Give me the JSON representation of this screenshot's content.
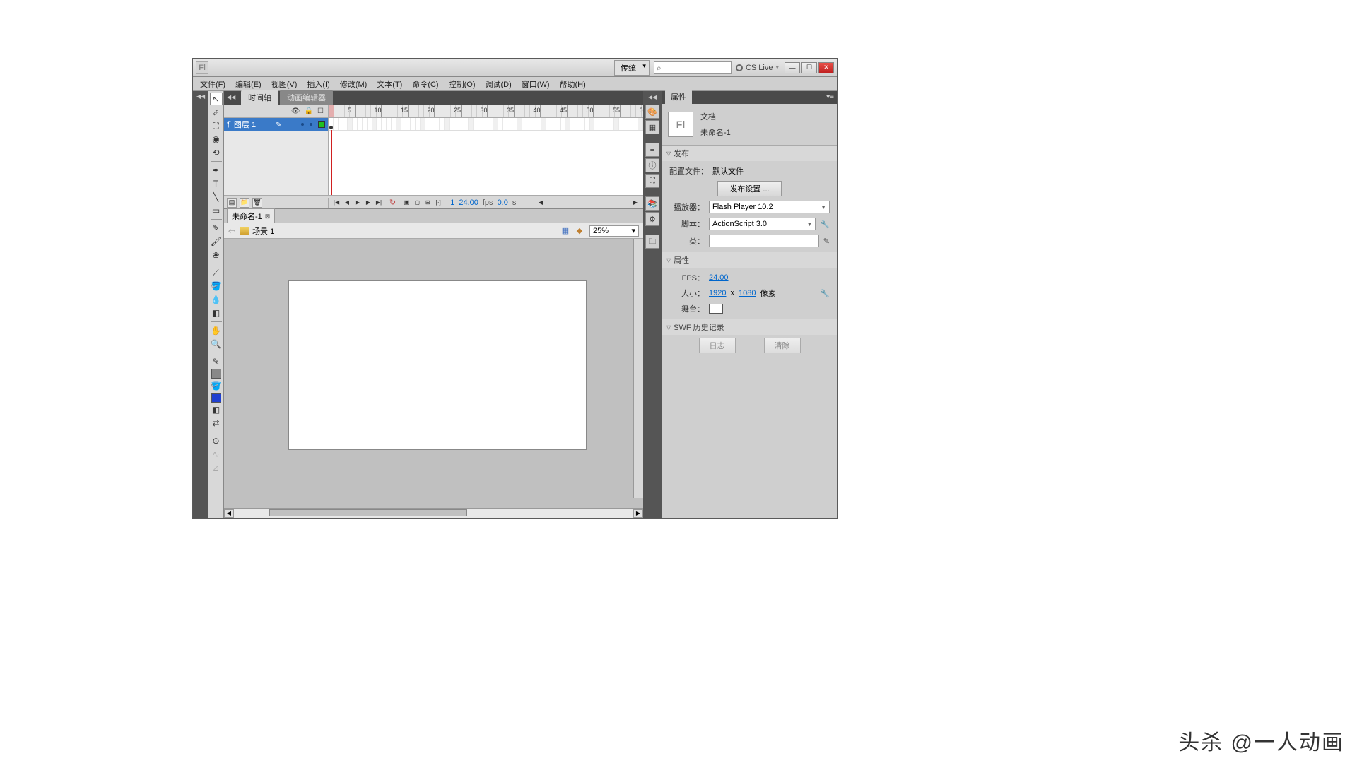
{
  "titlebar": {
    "workspace": "传统",
    "cslive": "CS Live"
  },
  "menu": [
    "文件(F)",
    "编辑(E)",
    "视图(V)",
    "插入(I)",
    "修改(M)",
    "文本(T)",
    "命令(C)",
    "控制(O)",
    "调试(D)",
    "窗口(W)",
    "帮助(H)"
  ],
  "timeline": {
    "tabs": [
      "时间轴",
      "动画编辑器"
    ],
    "layer_name": "图层 1",
    "frame": "1",
    "fps": "24.00",
    "fps_unit": "fps",
    "time": "0.0",
    "time_unit": "s"
  },
  "doc_tab": "未命名-1",
  "edit_bar": {
    "scene": "场景 1",
    "zoom": "25%"
  },
  "props": {
    "tab": "属性",
    "doc_type": "文档",
    "doc_name": "未命名-1",
    "sec_publish": "发布",
    "profile_lbl": "配置文件：",
    "profile_val": "默认文件",
    "publish_btn": "发布设置 ...",
    "player_lbl": "播放器：",
    "player_val": "Flash Player 10.2",
    "script_lbl": "脚本：",
    "script_val": "ActionScript 3.0",
    "class_lbl": "类：",
    "sec_props": "属性",
    "fps_lbl": "FPS：",
    "fps_val": "24.00",
    "size_lbl": "大小：",
    "size_w": "1920",
    "size_x": "x",
    "size_h": "1080",
    "size_unit": "像素",
    "stage_lbl": "舞台：",
    "sec_hist": "SWF 历史记录",
    "log_btn": "日志",
    "clear_btn": "清除"
  },
  "watermark": "头杀 @一人动画"
}
